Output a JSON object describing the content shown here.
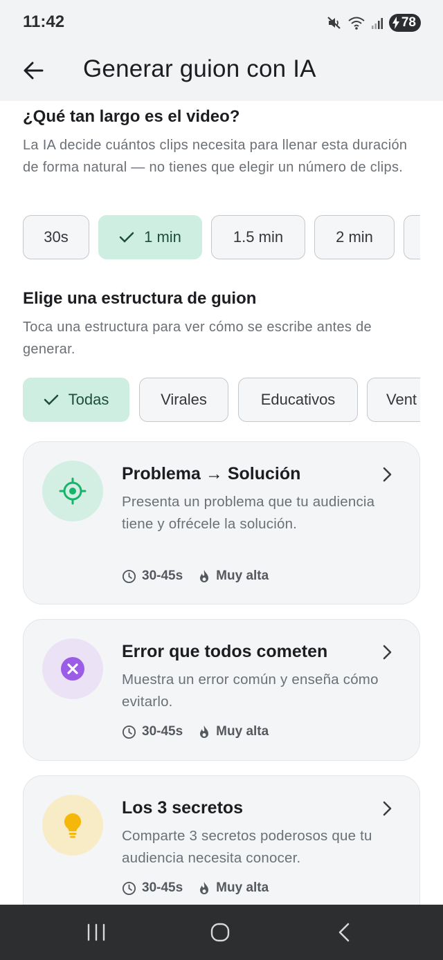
{
  "status": {
    "time": "11:42",
    "battery": "78"
  },
  "appbar": {
    "title": "Generar guion con IA"
  },
  "length": {
    "title": "¿Qué tan largo es el video?",
    "subtitle": "La IA decide cuántos clips necesita para llenar esta duración de forma natural — no tienes que elegir un número de clips.",
    "options": [
      "30s",
      "1 min",
      "1.5 min",
      "2 min",
      ""
    ],
    "selected": "1 min"
  },
  "structure": {
    "title": "Elige una estructura de guion",
    "subtitle": "Toca una estructura para ver cómo se escribe antes de generar.",
    "filters": [
      "Todas",
      "Virales",
      "Educativos",
      "Vent"
    ],
    "selected": "Todas"
  },
  "cards": [
    {
      "title": "Problema → Solución",
      "description": "Presenta un problema que tu audiencia tiene y ofrécele la solución.",
      "duration": "30-45s",
      "popularity": "Muy alta",
      "icon": "target-icon",
      "icon_color": "#18b26b",
      "icon_bg": "#d3efe3"
    },
    {
      "title": "Error que todos cometen",
      "description": "Muestra un error común y enseña cómo evitarlo.",
      "duration": "30-45s",
      "popularity": "Muy alta",
      "icon": "x-circle-icon",
      "icon_color": "#9b5de5",
      "icon_bg": "#ebe3f5"
    },
    {
      "title": "Los 3 secretos",
      "description": "Comparte 3 secretos poderosos que tu audiencia necesita conocer.",
      "duration": "30-45s",
      "popularity": "Muy alta",
      "icon": "lightbulb-icon",
      "icon_color": "#f5b80a",
      "icon_bg": "#f8ecc6"
    }
  ],
  "colors": {
    "accent": "#cdeee0",
    "topbar": "#f1f3f4",
    "navbar": "#2d2e30"
  }
}
